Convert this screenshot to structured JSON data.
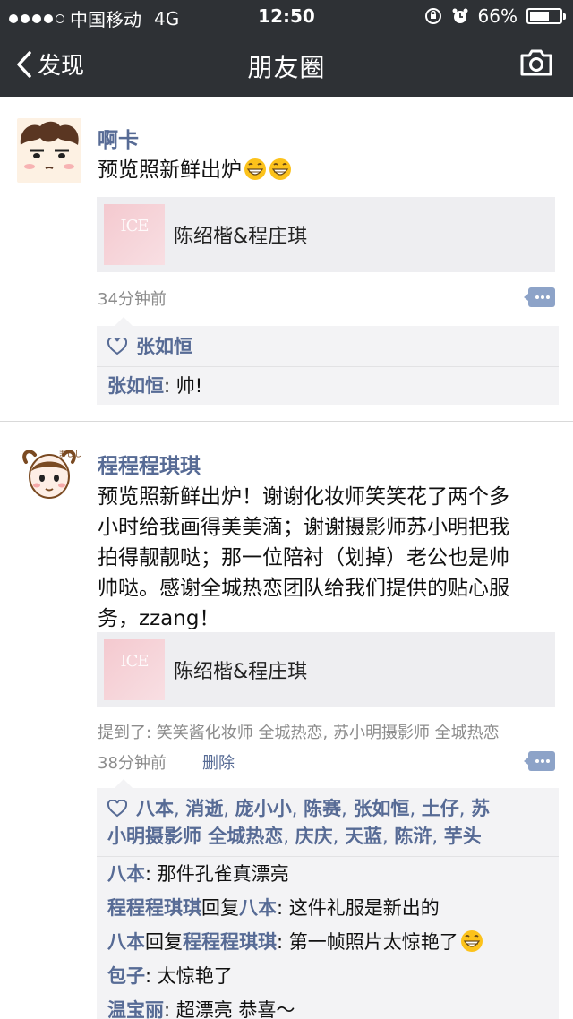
{
  "status": {
    "carrier": "中国移动",
    "network": "4G",
    "time": "12:50",
    "battery": "66%",
    "battery_level": 0.66
  },
  "nav": {
    "back_label": "发现",
    "title": "朋友圈"
  },
  "posts": [
    {
      "author": "啊卡",
      "text": "预览照新鲜出炉",
      "link_thumb": "ICE",
      "link_title": "陈绍楷&程庄琪",
      "time": "34分钟前",
      "likes": [
        "张如恒"
      ],
      "comments": [
        {
          "user": "张如恒",
          "text": ": 帅!"
        }
      ]
    },
    {
      "author": "程程程琪琪",
      "text_lines": [
        "预览照新鲜出炉！谢谢化妆师笑笑花了两个多",
        "小时给我画得美美滴；谢谢摄影师苏小明把我",
        "拍得靓靓哒；那一位陪衬（划掉）老公也是帅",
        "帅哒。感谢全城热恋团队给我们提供的贴心服",
        "务，zzang！"
      ],
      "link_thumb": "ICE",
      "link_title": "陈绍楷&程庄琪",
      "mention": "提到了: 笑笑酱化妆师 全城热恋, 苏小明摄影师 全城热恋",
      "time": "38分钟前",
      "delete_label": "删除",
      "likes_line1": [
        "八本",
        "消逝",
        "庞小小",
        "陈赛",
        "张如恒",
        "土仔",
        "苏"
      ],
      "likes_line2": [
        "小明摄影师 全城热恋",
        "庆庆",
        "天蓝",
        "陈浒",
        "芋头"
      ],
      "like_sep": ", ",
      "comments": [
        {
          "user": "八本",
          "text": ": 那件孔雀真漂亮"
        },
        {
          "user": "程程程琪琪",
          "mid": "回复",
          "user2": "八本",
          "text": ": 这件礼服是新出的"
        },
        {
          "user": "八本",
          "mid": "回复",
          "user2": "程程程琪琪",
          "text": ": 第一帧照片太惊艳了"
        },
        {
          "user": "包子",
          "text": ": 太惊艳了"
        },
        {
          "user": "温宝丽",
          "text": ": 超漂亮 恭喜～"
        }
      ]
    }
  ],
  "colors": {
    "bar": "#2e3135",
    "link_blue": "#576b95",
    "comment_bg": "#f3f3f5"
  }
}
